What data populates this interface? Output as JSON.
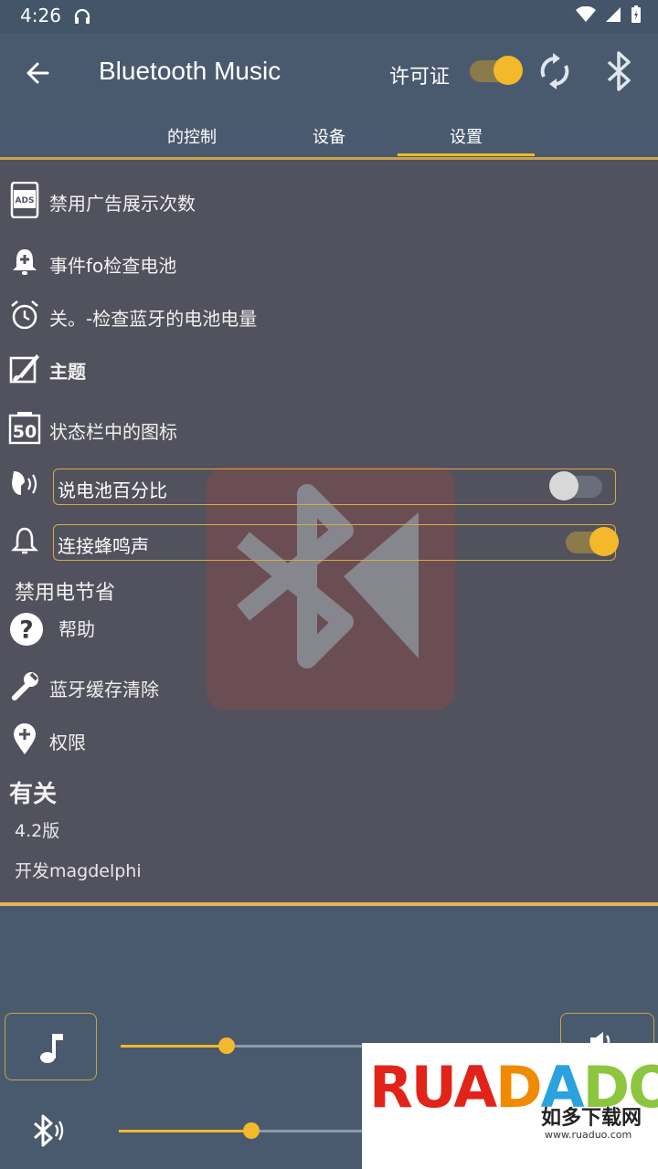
{
  "status_bar": {
    "time": "4:26"
  },
  "app_bar": {
    "title": "Bluetooth Music",
    "license_label": "许可证",
    "license_on": true
  },
  "tabs": [
    {
      "label": "的控制",
      "active": false
    },
    {
      "label": "设备",
      "active": false
    },
    {
      "label": "设置",
      "active": true
    }
  ],
  "settings": {
    "disable_ads": "禁用广告展示次数",
    "event_battery": "事件fo检查电池",
    "check_bt_battery": "关。-检查蓝牙的电池电量",
    "theme": "主题",
    "status_icon": "状态栏中的图标",
    "status_icon_badge": "50",
    "ads_badge": "ADS",
    "speak_battery": {
      "label": "说电池百分比",
      "on": false
    },
    "connect_beep": {
      "label": "连接蜂鸣声",
      "on": true
    },
    "disable_power_saving": "禁用电节省",
    "help": "帮助",
    "clear_bt_cache": "蓝牙缓存清除",
    "permissions": "权限",
    "about_header": "有关",
    "version": "4.2版",
    "developer": "开发magdelphi"
  },
  "bottom": {
    "music_volume": 0.4,
    "bt_volume": 0.5
  },
  "ad_banner": {
    "brand": "RUANDUO",
    "cn_text": "如多下载网",
    "url": "www.ruaduo.com"
  },
  "colors": {
    "accent": "#f3b92b",
    "toolbar_bg": "#4a5a6e",
    "content_bg": "#52525e"
  }
}
